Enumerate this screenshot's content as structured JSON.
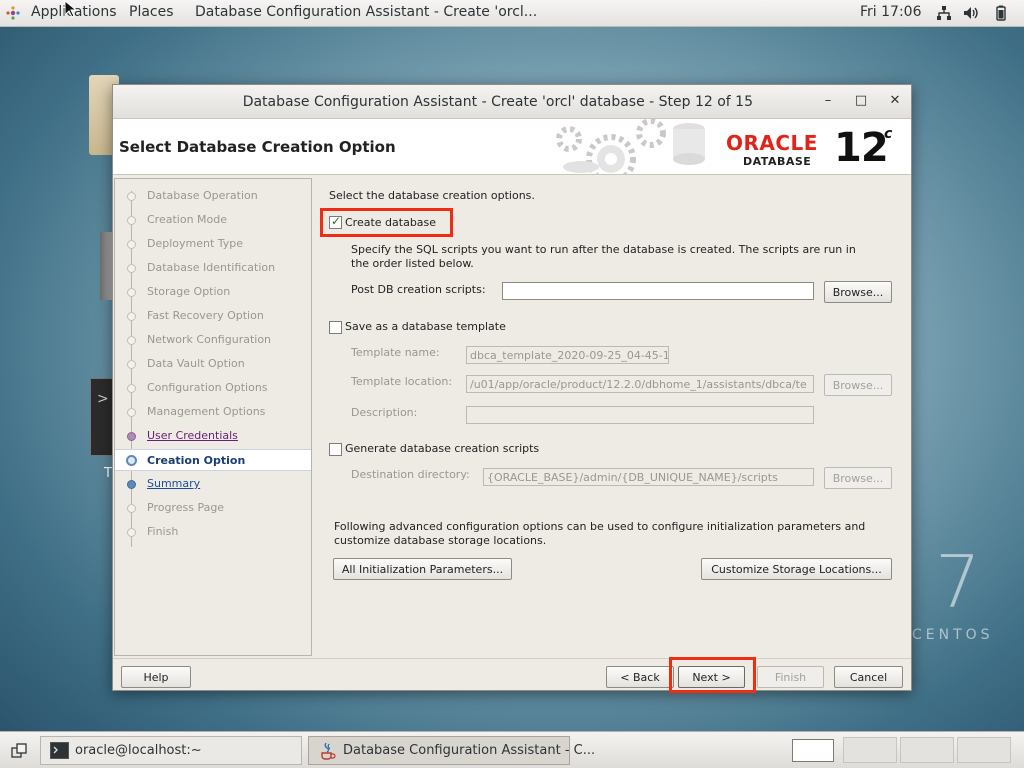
{
  "topbar": {
    "applications": "Applications",
    "places": "Places",
    "window_title": "Database Configuration Assistant - Create 'orcl...",
    "clock": "Fri 17:06",
    "icons": [
      "network-icon",
      "volume-icon",
      "battery-icon"
    ]
  },
  "desktop": {
    "partial_label": "T",
    "centos_number": "7",
    "centos_word": "CENTOS"
  },
  "dialog": {
    "title": "Database Configuration Assistant - Create 'orcl' database - Step 12 of 15",
    "minimize": "–",
    "maximize": "□",
    "close": "✕",
    "page_title": "Select Database Creation Option",
    "logo": {
      "oracle": "ORACLE",
      "database": "DATABASE",
      "version": "12",
      "suffix": "c"
    },
    "steps": [
      {
        "label": "Database Operation",
        "state": "pending"
      },
      {
        "label": "Creation Mode",
        "state": "pending"
      },
      {
        "label": "Deployment Type",
        "state": "pending"
      },
      {
        "label": "Database Identification",
        "state": "pending"
      },
      {
        "label": "Storage Option",
        "state": "pending"
      },
      {
        "label": "Fast Recovery Option",
        "state": "pending"
      },
      {
        "label": "Network Configuration",
        "state": "pending"
      },
      {
        "label": "Data Vault Option",
        "state": "pending"
      },
      {
        "label": "Configuration Options",
        "state": "pending"
      },
      {
        "label": "Management Options",
        "state": "pending"
      },
      {
        "label": "User Credentials",
        "state": "done"
      },
      {
        "label": "Creation Option",
        "state": "current"
      },
      {
        "label": "Summary",
        "state": "next"
      },
      {
        "label": "Progress Page",
        "state": "pending"
      },
      {
        "label": "Finish",
        "state": "pending"
      }
    ],
    "content": {
      "intro": "Select the database creation options.",
      "create_db_label": "Create database",
      "create_db_checked": true,
      "sql_desc_1": "Specify the SQL scripts you want to run after the database is created. The scripts are run in",
      "sql_desc_2": "the order listed below.",
      "post_db_label": "Post DB creation scripts:",
      "post_db_value": "",
      "browse": "Browse...",
      "template_cb_label": "Save as a database template",
      "template_checked": false,
      "template_name_label": "Template name:",
      "template_name_value": "dbca_template_2020-09-25_04-45-1",
      "template_location_label": "Template location:",
      "template_location_value": "/u01/app/oracle/product/12.2.0/dbhome_1/assistants/dbca/te",
      "description_label": "Description:",
      "description_value": "",
      "gen_scripts_label": "Generate database creation scripts",
      "gen_scripts_checked": false,
      "dest_dir_label": "Destination directory:",
      "dest_dir_value": "{ORACLE_BASE}/admin/{DB_UNIQUE_NAME}/scripts",
      "advanced_1": "Following advanced configuration options can be used to configure initialization parameters and",
      "advanced_2": "customize database storage locations.",
      "init_params_button": "All Initialization Parameters...",
      "storage_button": "Customize Storage Locations..."
    },
    "footer": {
      "help": "Help",
      "back": "< Back",
      "next": "Next >",
      "finish": "Finish",
      "cancel": "Cancel"
    }
  },
  "taskbar": {
    "terminal_task": "oracle@localhost:~",
    "dbca_task": "Database Configuration Assistant - C..."
  },
  "colors": {
    "highlight_red": "#ef2d12",
    "oracle_red": "#e2231a",
    "current_step_blue": "#1a3d73",
    "visited_step_purple": "#6a1e74"
  }
}
